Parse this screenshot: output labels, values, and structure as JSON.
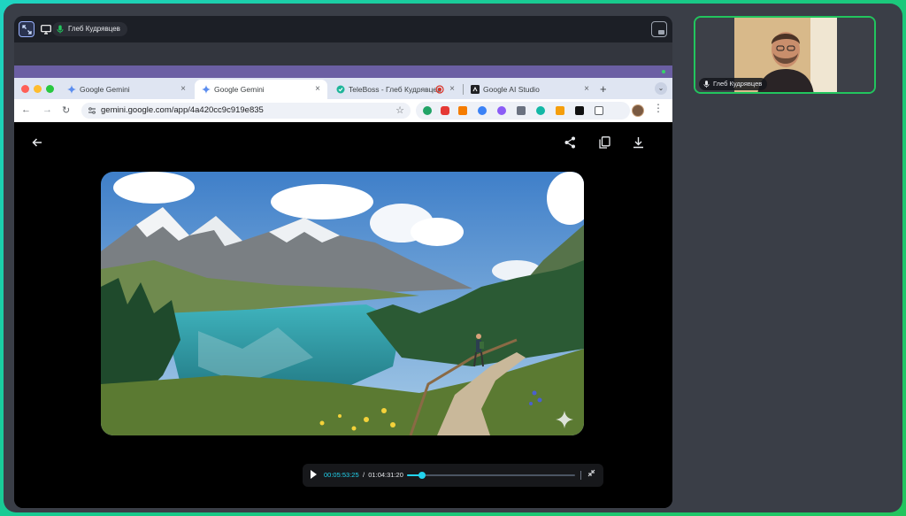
{
  "presenter": {
    "name": "Глеб Кудрявцев"
  },
  "browser": {
    "tabs": [
      {
        "title": "Google Gemini",
        "icon": "gemini-icon",
        "active": false
      },
      {
        "title": "Google Gemini",
        "icon": "gemini-icon",
        "active": true
      },
      {
        "title": "TeleBoss - Глеб Кудрявцев",
        "icon": "teleboss-icon",
        "active": false
      },
      {
        "title": "Google AI Studio",
        "icon": "ai-studio-icon",
        "active": false
      }
    ],
    "close_glyph": "×",
    "new_tab_glyph": "+",
    "url": "gemini.google.com/app/4a420cc9c919e835"
  },
  "viewer": {
    "icons": [
      "back-arrow-icon",
      "share-icon",
      "copy-icon",
      "download-icon"
    ],
    "image_description": "mountain-lake-with-hiker"
  },
  "video": {
    "elapsed": "00:05:53:25",
    "separator": "/",
    "total": "01:04:31:20",
    "progress": 0.092
  },
  "colors": {
    "accent": "#22d3ee",
    "speaking_border": "#22c55e",
    "window_bg": "#3a3e47"
  },
  "webcam": {
    "name": "Глеб Кудрявцев"
  }
}
